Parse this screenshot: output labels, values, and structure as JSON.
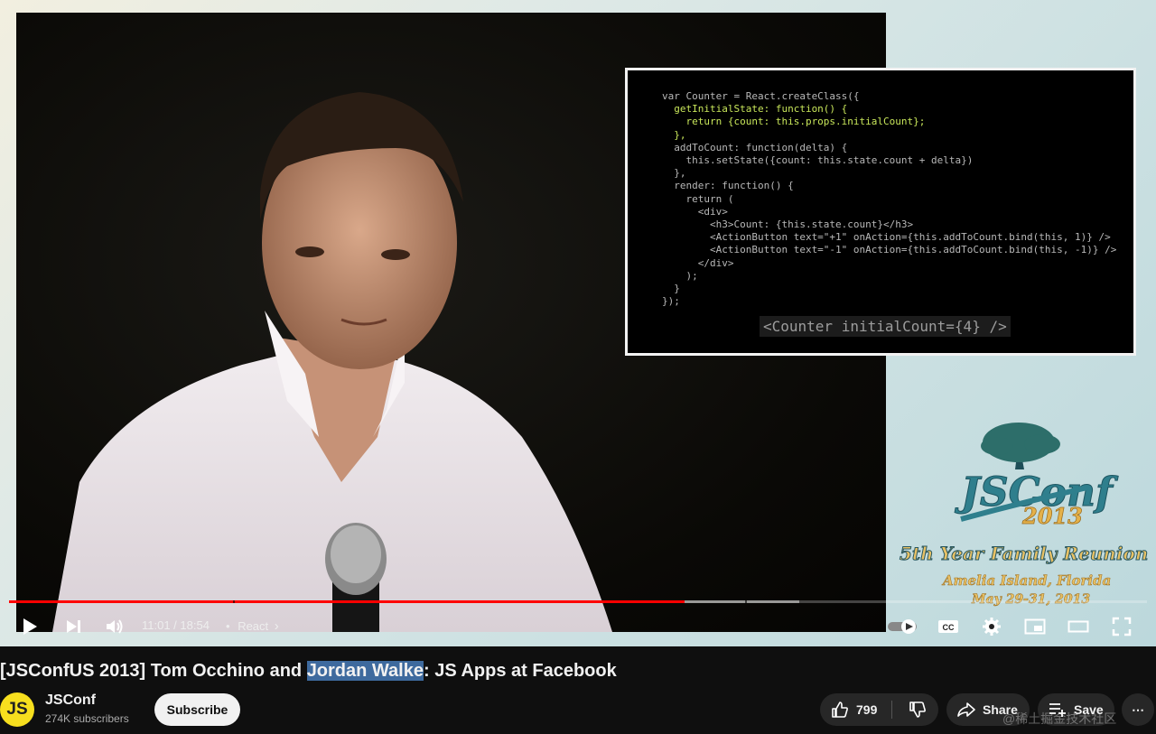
{
  "player": {
    "slide": {
      "code_lines": [
        {
          "text": "var Counter = React.createClass({",
          "hl": false
        },
        {
          "text": "  getInitialState: function() {",
          "hl": true
        },
        {
          "text": "    return {count: this.props.initialCount};",
          "hl": true
        },
        {
          "text": "  },",
          "hl": true
        },
        {
          "text": "  addToCount: function(delta) {",
          "hl": false
        },
        {
          "text": "    this.setState({count: this.state.count + delta})",
          "hl": false
        },
        {
          "text": "  },",
          "hl": false
        },
        {
          "text": "  render: function() {",
          "hl": false
        },
        {
          "text": "    return (",
          "hl": false
        },
        {
          "text": "      <div>",
          "hl": false
        },
        {
          "text": "        <h3>Count: {this.state.count}</h3>",
          "hl": false
        },
        {
          "text": "        <ActionButton text=\"+1\" onAction={this.addToCount.bind(this, 1)} />",
          "hl": false
        },
        {
          "text": "        <ActionButton text=\"-1\" onAction={this.addToCount.bind(this, -1)} />",
          "hl": false
        },
        {
          "text": "      </div>",
          "hl": false
        },
        {
          "text": "    );",
          "hl": false
        },
        {
          "text": "  }",
          "hl": false
        },
        {
          "text": "});",
          "hl": false
        }
      ],
      "jsx_usage": "<Counter initialCount={4} />"
    },
    "logo": {
      "brand": "JSConf",
      "year": "2013",
      "tagline": "5th Year Family Reunion",
      "location": "Amelia Island, Florida",
      "dates": "May 29-31, 2013"
    },
    "progress": {
      "played_fraction": 0.5939,
      "buffered_fraction": 0.6944,
      "chapter_fractions": [
        0.1968,
        0.6469
      ]
    },
    "controls": {
      "time": "11:01 / 18:54",
      "separator": "•",
      "chapter": "React",
      "chapter_icon": "chevron-right-icon",
      "icons": [
        "play-icon",
        "next-icon",
        "volume-icon",
        "autoplay-toggle",
        "captions-icon",
        "settings-icon",
        "miniplayer-icon",
        "theater-icon",
        "fullscreen-icon"
      ]
    }
  },
  "video": {
    "title_before": "[JSConfUS 2013] Tom Occhino and ",
    "title_selected": "Jordan Walke",
    "title_after": ": JS Apps at Facebook"
  },
  "channel": {
    "avatar_text": "JS",
    "name": "JSConf",
    "subscribers": "274K subscribers",
    "subscribe_label": "Subscribe"
  },
  "actions": {
    "like_count": "799",
    "share_label": "Share",
    "save_label": "Save",
    "more_label": "⋯"
  },
  "watermark": "@稀土掘金技术社区",
  "colors": {
    "progress_played": "#ff0000",
    "background": "#0f0f0f",
    "avatar_bg": "#f7df1e",
    "code_highlight": "#c8e65a",
    "selection": "#3e6a9e"
  }
}
